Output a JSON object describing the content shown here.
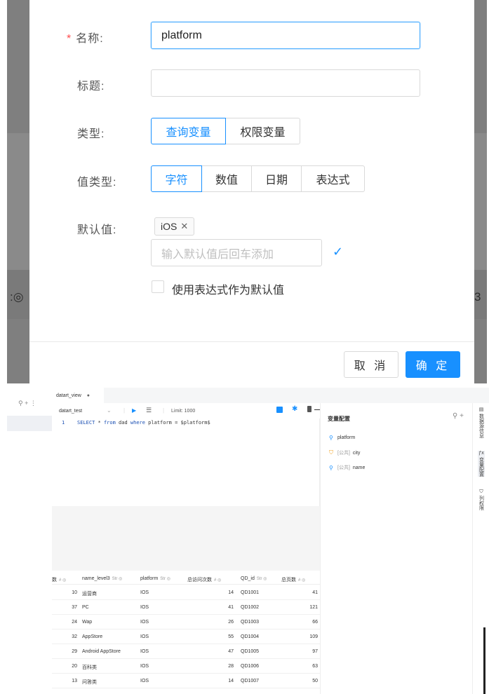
{
  "dialog": {
    "name_label": "名称:",
    "name_value": "platform",
    "title_label": "标题:",
    "title_value": "",
    "type_label": "类型:",
    "type_options": [
      "查询变量",
      "权限变量"
    ],
    "value_type_label": "值类型:",
    "value_type_options": [
      "字符",
      "数值",
      "日期",
      "表达式"
    ],
    "default_label": "默认值:",
    "default_tag": "iOS",
    "default_placeholder": "输入默认值后回车添加",
    "expression_checkbox_label": "使用表达式作为默认值",
    "cancel_label": "取 消",
    "ok_label": "确 定",
    "accent_color": "#1890ff"
  },
  "editor": {
    "tab_name": "datart_view",
    "source_name": "datart_test",
    "limit_label": "Limit: 1000",
    "line_number": "1",
    "sql_parts": {
      "kw_select": "SELECT",
      "star": " * ",
      "kw_from": "from",
      "table": " dad ",
      "kw_where": "where",
      "rest": " platform = $platform$"
    }
  },
  "variables_panel": {
    "title": "变量配置",
    "items": [
      {
        "scope": "",
        "name": "platform"
      },
      {
        "scope": "[公共]",
        "name": "city"
      },
      {
        "scope": "[公共]",
        "name": "name"
      }
    ]
  },
  "right_rail": {
    "items": [
      "数据源信息",
      "变量配置",
      "列权限"
    ]
  },
  "results_table": {
    "columns": [
      "数",
      "name_level3",
      "platform",
      "总访问次数",
      "QD_id",
      "总页数"
    ],
    "rows": [
      {
        "c0": "10",
        "name": "运营商",
        "platform": "IOS",
        "visits": "14",
        "qd": "QD1001",
        "pages": "41"
      },
      {
        "c0": "37",
        "name": "PC",
        "platform": "IOS",
        "visits": "41",
        "qd": "QD1002",
        "pages": "121"
      },
      {
        "c0": "24",
        "name": "Wap",
        "platform": "IOS",
        "visits": "26",
        "qd": "QD1003",
        "pages": "66"
      },
      {
        "c0": "32",
        "name": "AppStore",
        "platform": "IOS",
        "visits": "55",
        "qd": "QD1004",
        "pages": "109"
      },
      {
        "c0": "29",
        "name": "Android AppStore",
        "platform": "IOS",
        "visits": "47",
        "qd": "QD1005",
        "pages": "97"
      },
      {
        "c0": "20",
        "name": "百科类",
        "platform": "IOS",
        "visits": "28",
        "qd": "QD1006",
        "pages": "63"
      },
      {
        "c0": "13",
        "name": "问答类",
        "platform": "IOS",
        "visits": "14",
        "qd": "QD1007",
        "pages": "50"
      }
    ]
  }
}
